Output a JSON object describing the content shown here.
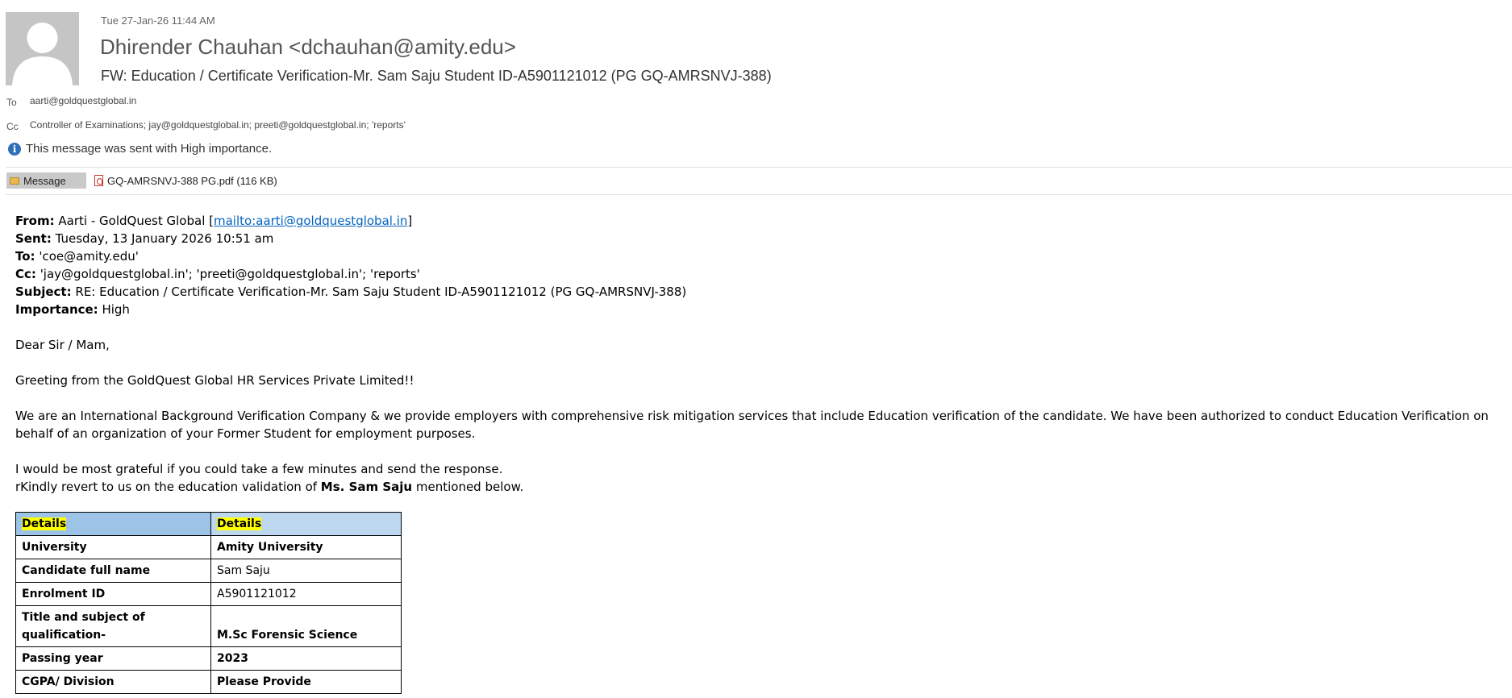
{
  "header": {
    "sent_time": "Tue 27-Jan-26 11:44 AM",
    "sender": "Dhirender Chauhan <dchauhan@amity.edu>",
    "subject": "FW: Education / Certificate Verification-Mr. Sam Saju Student ID-A5901121012 (PG GQ-AMRSNVJ-388)",
    "to_label": "To",
    "to_value": "aarti@goldquestglobal.in",
    "cc_label": "Cc",
    "cc_value": "Controller of Examinations; jay@goldquestglobal.in; preeti@goldquestglobal.in; 'reports'",
    "importance_notice": "This message was sent with High importance.",
    "avatar_icon": "person-avatar-icon",
    "info_icon": "info-icon"
  },
  "attachments": {
    "message_tab": "Message",
    "file": "GQ-AMRSNVJ-388 PG.pdf (116 KB)"
  },
  "body": {
    "from_label": "From:",
    "from_text": "Aarti - GoldQuest Global [",
    "from_link": "mailto:aarti@goldquestglobal.in",
    "from_close": "]",
    "sent_label": "Sent:",
    "sent_value": "Tuesday, 13 January 2026 10:51 am",
    "to_label": "To:",
    "to_value": "'coe@amity.edu'",
    "cc_label": "Cc:",
    "cc_value": "'jay@goldquestglobal.in'; 'preeti@goldquestglobal.in'; 'reports'",
    "subject_label": "Subject:",
    "subject_value": "RE: Education / Certificate Verification-Mr. Sam Saju Student ID-A5901121012 (PG GQ-AMRSNVJ-388)",
    "importance_label": "Importance:",
    "importance_value": "High",
    "greeting": "Dear Sir / Mam,",
    "intro": "Greeting from the GoldQuest Global HR Services Private Limited!!",
    "para1": "We are an International Background Verification Company & we provide employers with comprehensive risk mitigation services that include Education verification of the candidate. We have been authorized to conduct Education Verification on behalf of an organization of your Former Student for employment purposes.",
    "para2": "I would be most grateful if you could take a few minutes and send the response.",
    "para3_prefix": "rKindly revert to us on the education validation of ",
    "para3_name": "Ms. Sam Saju",
    "para3_suffix": " mentioned below."
  },
  "table": {
    "header": [
      "Details",
      "Details"
    ],
    "rows": [
      {
        "label": "University",
        "value": "Amity University"
      },
      {
        "label": "Candidate full name",
        "value": "Sam Saju"
      },
      {
        "label": "Enrolment ID",
        "value": "A5901121012"
      },
      {
        "label": "Title and subject of qualification-",
        "value": "M.Sc Forensic Science"
      },
      {
        "label": "Passing year",
        "value": "2023"
      },
      {
        "label": "CGPA/ Division",
        "value": "Please Provide"
      }
    ]
  }
}
